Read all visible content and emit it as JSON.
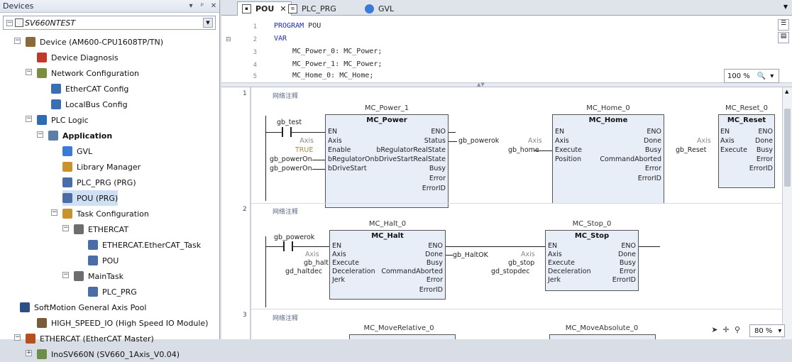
{
  "devices_panel": {
    "title": "Devices",
    "header_buttons": [
      "▾",
      "ᵖ",
      "✕"
    ],
    "project_combo": "SV660NTEST",
    "tree": [
      {
        "label": "Device (AM600-CPU1608TP/TN)",
        "icon": "device-icon"
      },
      {
        "label": "Device Diagnosis",
        "icon": "diagnosis-icon"
      },
      {
        "label": "Network Configuration",
        "icon": "network-icon"
      },
      {
        "label": "EtherCAT Config",
        "icon": "ethercat-config-icon"
      },
      {
        "label": "LocalBus Config",
        "icon": "localbus-icon"
      },
      {
        "label": "PLC Logic",
        "icon": "plc-logic-icon"
      },
      {
        "label": "Application",
        "icon": "application-icon"
      },
      {
        "label": "GVL",
        "icon": "gvl-icon"
      },
      {
        "label": "Library Manager",
        "icon": "library-icon"
      },
      {
        "label": "PLC_PRG (PRG)",
        "icon": "program-icon"
      },
      {
        "label": "POU (PRG)",
        "icon": "program-icon"
      },
      {
        "label": "Task Configuration",
        "icon": "task-config-icon"
      },
      {
        "label": "ETHERCAT",
        "icon": "task-icon"
      },
      {
        "label": "ETHERCAT.EtherCAT_Task",
        "icon": "task-call-icon"
      },
      {
        "label": "POU",
        "icon": "task-call-icon"
      },
      {
        "label": "MainTask",
        "icon": "task-icon"
      },
      {
        "label": "PLC_PRG",
        "icon": "task-call-icon"
      },
      {
        "label": "SoftMotion General Axis Pool",
        "icon": "axis-pool-icon"
      },
      {
        "label": "HIGH_SPEED_IO (High Speed IO Module)",
        "icon": "io-module-icon"
      },
      {
        "label": "ETHERCAT (EtherCAT Master)",
        "icon": "ethercat-master-icon"
      },
      {
        "label": "InoSV660N (SV660_1Axis_V0.04)",
        "icon": "servo-icon"
      }
    ]
  },
  "tabs": [
    {
      "label": "POU",
      "close": "✕"
    },
    {
      "label": "PLC_PRG"
    },
    {
      "label": "GVL"
    }
  ],
  "declarations": {
    "line_numbers": [
      "1",
      "2",
      "3",
      "4",
      "5"
    ],
    "lines": [
      {
        "kw": "PROGRAM",
        "text": " POU"
      },
      {
        "kw": "VAR",
        "text": ""
      },
      {
        "kw": "",
        "text": "MC_Power_0: MC_Power;"
      },
      {
        "kw": "",
        "text": "MC_Power_1: MC_Power;"
      },
      {
        "kw": "",
        "text": "MC_Home_0: MC_Home;"
      }
    ],
    "zoom": "100 %"
  },
  "networks": [
    {
      "number": "1",
      "comment": "网络注释"
    },
    {
      "number": "2",
      "comment": "网络注释"
    },
    {
      "number": "3",
      "comment": "网络注释"
    }
  ],
  "net1": {
    "contact_var": "gb_test",
    "power": {
      "instance": "MC_Power_1",
      "type": "MC_Power",
      "inputs": [
        "EN",
        "Axis",
        "Enable",
        "bRegulatorOn",
        "bDriveStart"
      ],
      "outputs": [
        "ENO",
        "Status",
        "bRegulatorRealState",
        "bDriveStartRealState",
        "Busy",
        "Error",
        "ErrorID"
      ],
      "in_vars": [
        "Axis",
        "TRUE",
        "gb_powerOn",
        "gb_powerOn"
      ],
      "out_var": "gb_powerok"
    },
    "home": {
      "instance": "MC_Home_0",
      "type": "MC_Home",
      "inputs": [
        "EN",
        "Axis",
        "Execute",
        "Position"
      ],
      "outputs": [
        "ENO",
        "Done",
        "Busy",
        "CommandAborted",
        "Error",
        "ErrorID"
      ],
      "in_vars": [
        "Axis",
        "gb_home"
      ]
    },
    "reset": {
      "instance": "MC_Reset_0",
      "type": "MC_Reset",
      "inputs": [
        "EN",
        "Axis",
        "Execute"
      ],
      "outputs": [
        "ENO",
        "Done",
        "Busy",
        "Error",
        "ErrorID"
      ],
      "in_vars": [
        "Axis",
        "gb_Reset"
      ]
    }
  },
  "net2": {
    "contact_var": "gb_powerok",
    "halt": {
      "instance": "MC_Halt_0",
      "type": "MC_Halt",
      "inputs": [
        "EN",
        "Axis",
        "Execute",
        "Deceleration",
        "Jerk"
      ],
      "outputs": [
        "ENO",
        "Done",
        "Busy",
        "CommandAborted",
        "Error",
        "ErrorID"
      ],
      "in_vars": [
        "Axis",
        "gb_halt",
        "gd_haltdec"
      ],
      "out_var": "gb_HaltOK"
    },
    "stop": {
      "instance": "MC_Stop_0",
      "type": "MC_Stop",
      "inputs": [
        "EN",
        "Axis",
        "Execute",
        "Deceleration",
        "Jerk"
      ],
      "outputs": [
        "ENO",
        "Done",
        "Busy",
        "Error",
        "ErrorID"
      ],
      "in_vars": [
        "Axis",
        "gb_stop",
        "gd_stopdec"
      ]
    }
  },
  "net3": {
    "rel_instance": "MC_MoveRelative_0",
    "abs_instance": "MC_MoveAbsolute_0"
  },
  "fbd_zoom": "80 %"
}
